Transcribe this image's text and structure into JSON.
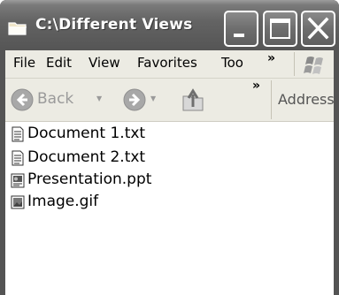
{
  "window": {
    "title": "C:\\Different Views",
    "icon": "folder-icon",
    "controls": {
      "minimize_icon": "minimize-icon",
      "maximize_icon": "maximize-icon",
      "close_icon": "close-icon"
    }
  },
  "menubar": {
    "items": [
      {
        "label": "File"
      },
      {
        "label": "Edit"
      },
      {
        "label": "View"
      },
      {
        "label": "Favorites"
      },
      {
        "label": "Too"
      }
    ],
    "overflow": "»",
    "logo_icon": "windows-flag-icon"
  },
  "toolbar": {
    "back_label": "Back",
    "back_dropdown": "▼",
    "forward_dropdown": "▼",
    "overflow": "»",
    "address_label": "Address"
  },
  "files": [
    {
      "name": "Document 1.txt",
      "icon": "text-file-icon"
    },
    {
      "name": "Document 2.txt",
      "icon": "text-file-icon"
    },
    {
      "name": "Presentation.ppt",
      "icon": "powerpoint-file-icon"
    },
    {
      "name": "Image.gif",
      "icon": "image-file-icon"
    }
  ],
  "colors": {
    "titlebar": "#5e5e5e",
    "menubar_bg": "#ecebe3",
    "content_bg": "#ffffff",
    "disabled_text": "#9a9a9a"
  }
}
